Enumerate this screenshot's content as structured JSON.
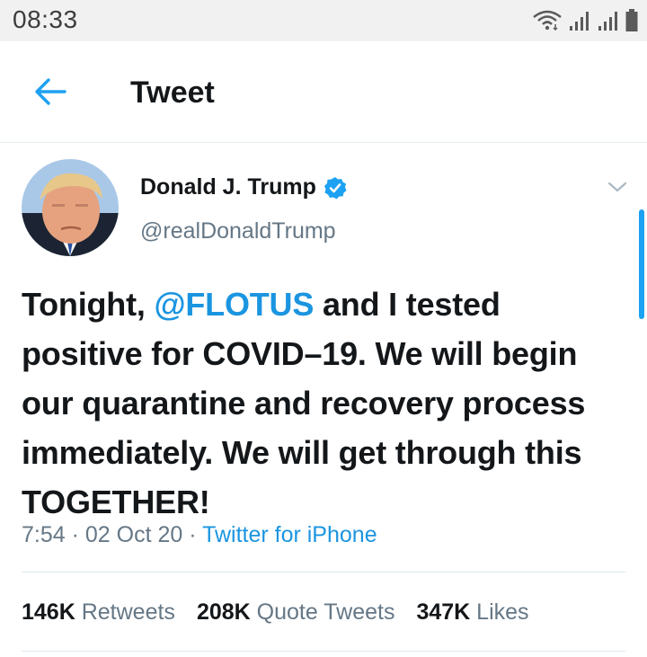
{
  "status_bar": {
    "time": "08:33",
    "icons": [
      "wifi-icon",
      "signal-icon",
      "signal-icon",
      "battery-icon"
    ]
  },
  "header": {
    "back_icon": "arrow-left-icon",
    "title": "Tweet"
  },
  "tweet": {
    "author_name": "Donald J. Trump",
    "author_handle": "@realDonaldTrump",
    "verified": true,
    "text_before": "Tonight, ",
    "mention": "@FLOTUS",
    "text_after": " and I tested positive for COVID–19. We will begin our quarantine and recovery process immediately. We will get through this TOGETHER!",
    "time": "7:54",
    "date": "02 Oct 20",
    "separator": " · ",
    "source": "Twitter for iPhone",
    "stats": {
      "retweets_count": "146K",
      "retweets_label": "Retweets",
      "quote_count": "208K",
      "quote_label": "Quote Tweets",
      "likes_count": "347K",
      "likes_label": "Likes"
    }
  },
  "colors": {
    "accent": "#1da1f2",
    "link": "#1b95e0",
    "secondary_text": "#657786",
    "primary_text": "#14171a",
    "status_bar_bg": "#f1f1f1"
  }
}
